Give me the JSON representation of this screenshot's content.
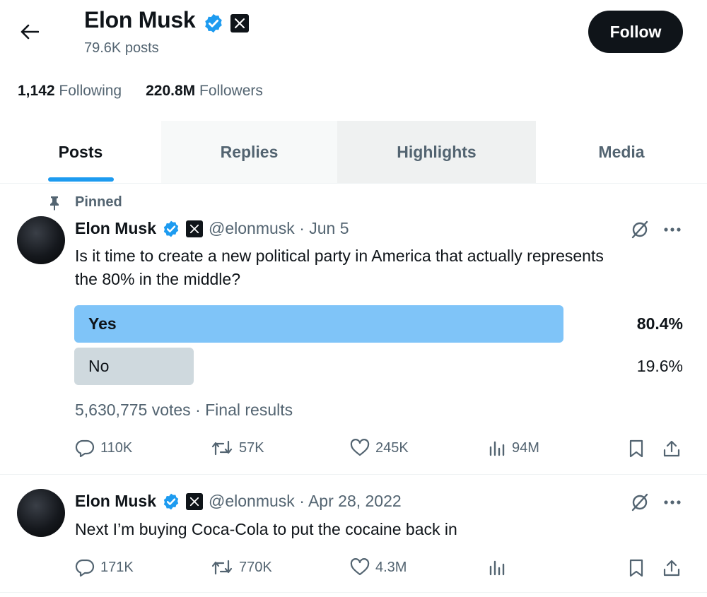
{
  "header": {
    "name": "Elon Musk",
    "post_count": "79.6K posts",
    "follow_label": "Follow"
  },
  "stats": {
    "following_count": "1,142",
    "following_label": "Following",
    "followers_count": "220.8M",
    "followers_label": "Followers"
  },
  "tabs": [
    {
      "label": "Posts"
    },
    {
      "label": "Replies"
    },
    {
      "label": "Highlights"
    },
    {
      "label": "Media"
    }
  ],
  "colors": {
    "accent": "#1d9bf0",
    "poll_winner": "#7fc4f8",
    "poll_loser": "#cfd9de",
    "text": "#0f1419",
    "muted": "#536471"
  },
  "posts": [
    {
      "pinned_label": "Pinned",
      "name": "Elon Musk",
      "handle_date": "@elonmusk · Jun 5",
      "text_line1": "Is it time to create a new political party in America that actually represents",
      "text_line2": "the 80% in the middle?",
      "poll": {
        "options": [
          {
            "label": "Yes",
            "percent": "80.4%",
            "fraction": 0.804,
            "winner": true
          },
          {
            "label": "No",
            "percent": "19.6%",
            "fraction": 0.196,
            "winner": false
          }
        ],
        "footer": "5,630,775 votes · Final results"
      },
      "actions": {
        "replies": "110K",
        "reposts": "57K",
        "likes": "245K",
        "views": "94M"
      }
    },
    {
      "name": "Elon Musk",
      "handle_date": "@elonmusk · Apr 28, 2022",
      "text_line1": "Next I’m buying Coca-Cola to put the cocaine back in",
      "actions": {
        "replies": "171K",
        "reposts": "770K",
        "likes": "4.3M",
        "views": ""
      }
    }
  ]
}
